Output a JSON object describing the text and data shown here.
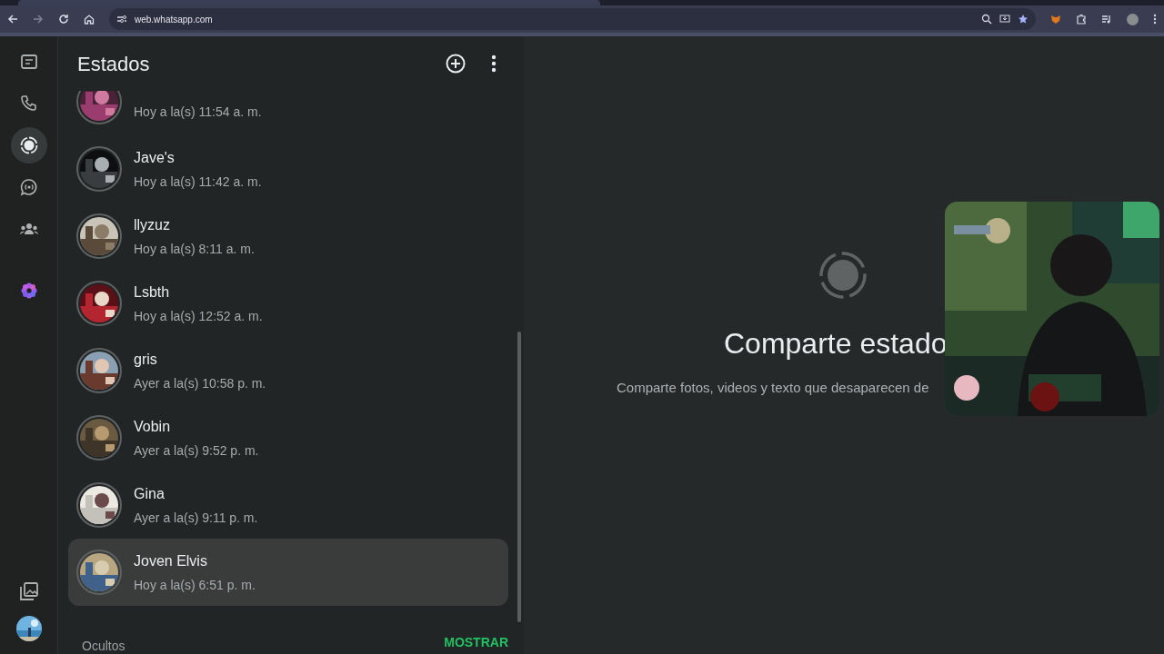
{
  "browser": {
    "url": "web.whatsapp.com"
  },
  "rail": {
    "items": [
      {
        "kind": "chats",
        "selected": false
      },
      {
        "kind": "calls",
        "selected": false
      },
      {
        "kind": "status",
        "selected": true
      },
      {
        "kind": "channels",
        "selected": false
      },
      {
        "kind": "communities",
        "selected": false
      },
      {
        "kind": "meta",
        "selected": false
      }
    ]
  },
  "header": {
    "title": "Estados"
  },
  "statuses": [
    {
      "time": "Hoy a la(s) 11:54 a. m.",
      "selected": false
    },
    {
      "name": "Jave's",
      "time": "Hoy a la(s) 11:42 a. m.",
      "selected": false
    },
    {
      "name": "llyzuz",
      "time": "Hoy a la(s) 8:11 a. m.",
      "selected": false
    },
    {
      "name": "Lsbth",
      "time": "Hoy a la(s) 12:52 a. m.",
      "selected": false
    },
    {
      "name": "gris",
      "time": "Ayer a la(s) 10:58 p. m.",
      "selected": false
    },
    {
      "name": "Vobin",
      "time": "Ayer a la(s) 9:52 p. m.",
      "selected": false
    },
    {
      "name": "Gina",
      "time": "Ayer a la(s) 9:11 p. m.",
      "selected": false
    },
    {
      "name": "Joven Elvis",
      "time": "Hoy a la(s) 6:51 p. m.",
      "selected": true
    }
  ],
  "hidden": {
    "label": "Ocultos",
    "action": "MOSTRAR"
  },
  "empty": {
    "title": "Comparte estado",
    "subtitle": "Comparte fotos, videos y texto que desaparecen de"
  }
}
